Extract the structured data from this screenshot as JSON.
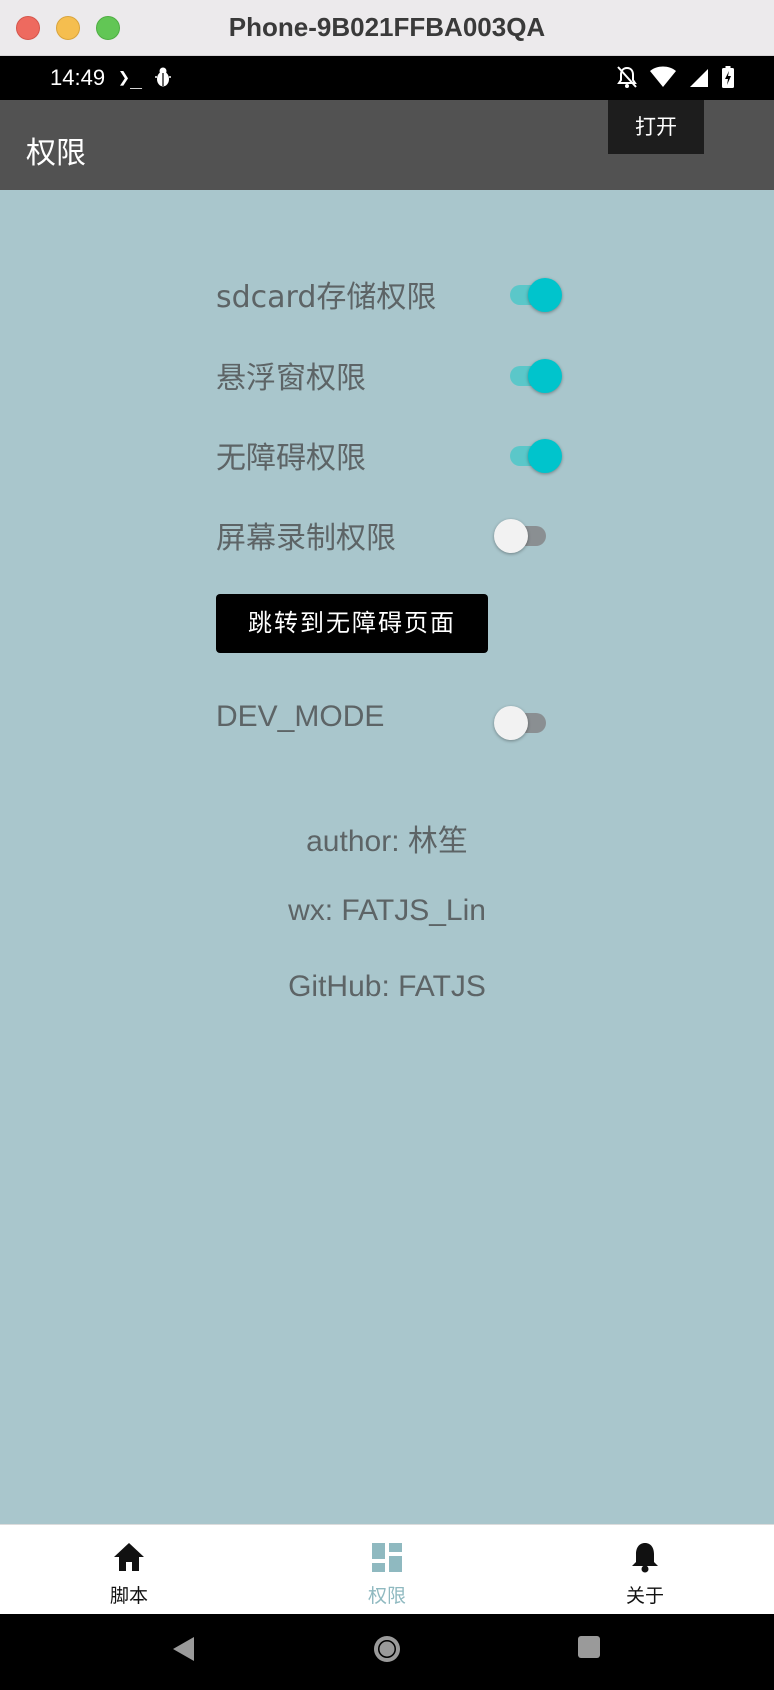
{
  "window": {
    "title": "Phone-9B021FFBA003QA"
  },
  "status_bar": {
    "time": "14:49",
    "terminal_glyph": "❯_",
    "icons": [
      "bug-icon",
      "mute-icon",
      "wifi-icon",
      "signal-icon",
      "battery-icon"
    ]
  },
  "app_bar": {
    "title": "权限",
    "action_label": "打开"
  },
  "permissions": [
    {
      "label": "sdcard存储权限",
      "enabled": true
    },
    {
      "label": "悬浮窗权限",
      "enabled": true
    },
    {
      "label": "无障碍权限",
      "enabled": true
    },
    {
      "label": "屏幕录制权限",
      "enabled": false
    }
  ],
  "jump_button": {
    "label": "跳转到无障碍页面"
  },
  "dev_mode": {
    "label": "DEV_MODE",
    "enabled": false
  },
  "info": {
    "author": "author: 林笙",
    "wx": "wx: FATJS_Lin",
    "github": "GitHub: FATJS"
  },
  "bottom_nav": {
    "items": [
      {
        "label": "脚本",
        "icon": "home-icon",
        "active": false
      },
      {
        "label": "权限",
        "icon": "dashboard-icon",
        "active": true
      },
      {
        "label": "关于",
        "icon": "bell-icon",
        "active": false
      }
    ]
  },
  "colors": {
    "screen_bg": "#a9c6cc",
    "app_bar": "#525252",
    "switch_on": "#00c4cc",
    "nav_active": "#8fb9c0"
  }
}
